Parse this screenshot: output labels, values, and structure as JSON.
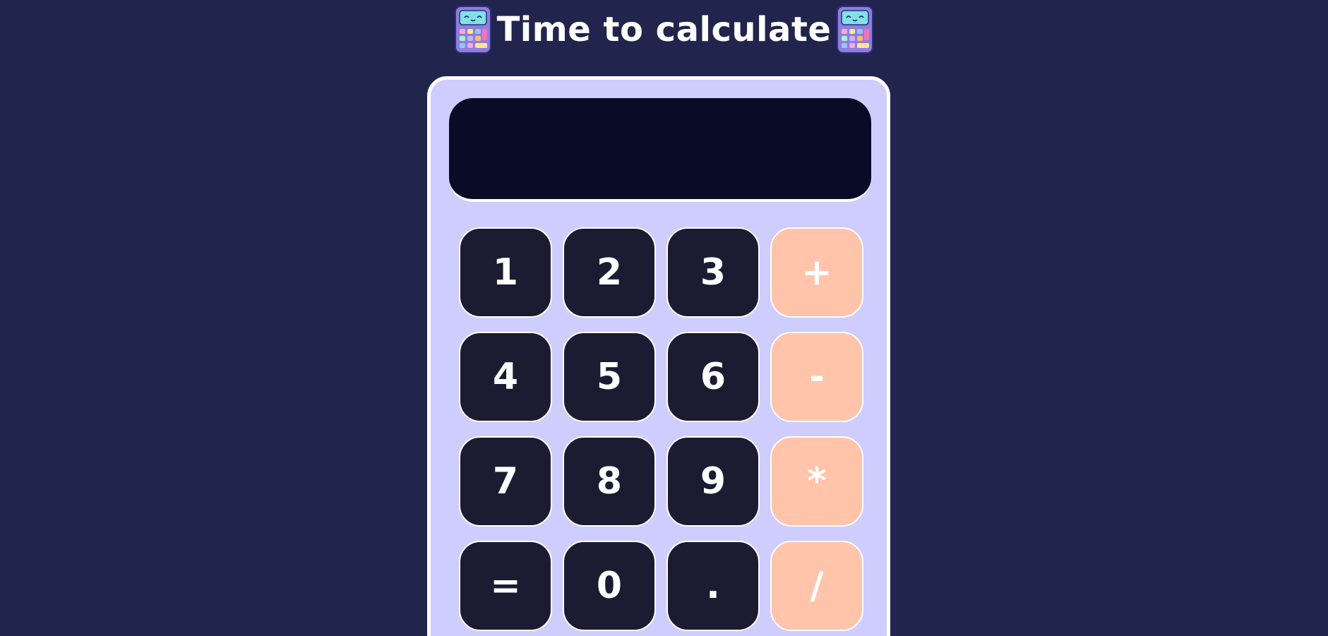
{
  "header": {
    "title": "Time to calculate"
  },
  "display": {
    "value": ""
  },
  "keys": {
    "k1": "1",
    "k2": "2",
    "k3": "3",
    "plus": "+",
    "k4": "4",
    "k5": "5",
    "k6": "6",
    "minus": "-",
    "k7": "7",
    "k8": "8",
    "k9": "9",
    "multiply": "*",
    "equals": "=",
    "k0": "0",
    "dot": ".",
    "divide": "/"
  },
  "icons": {
    "left": "calculator-emoji-icon",
    "right": "calculator-emoji-icon"
  },
  "colors": {
    "background": "#21254d",
    "calculator_body": "#cfcdfd",
    "display": "#0a0b26",
    "number_key": "#1b1c31",
    "operator_key": "#ffc4aa",
    "text": "#ffffff"
  }
}
